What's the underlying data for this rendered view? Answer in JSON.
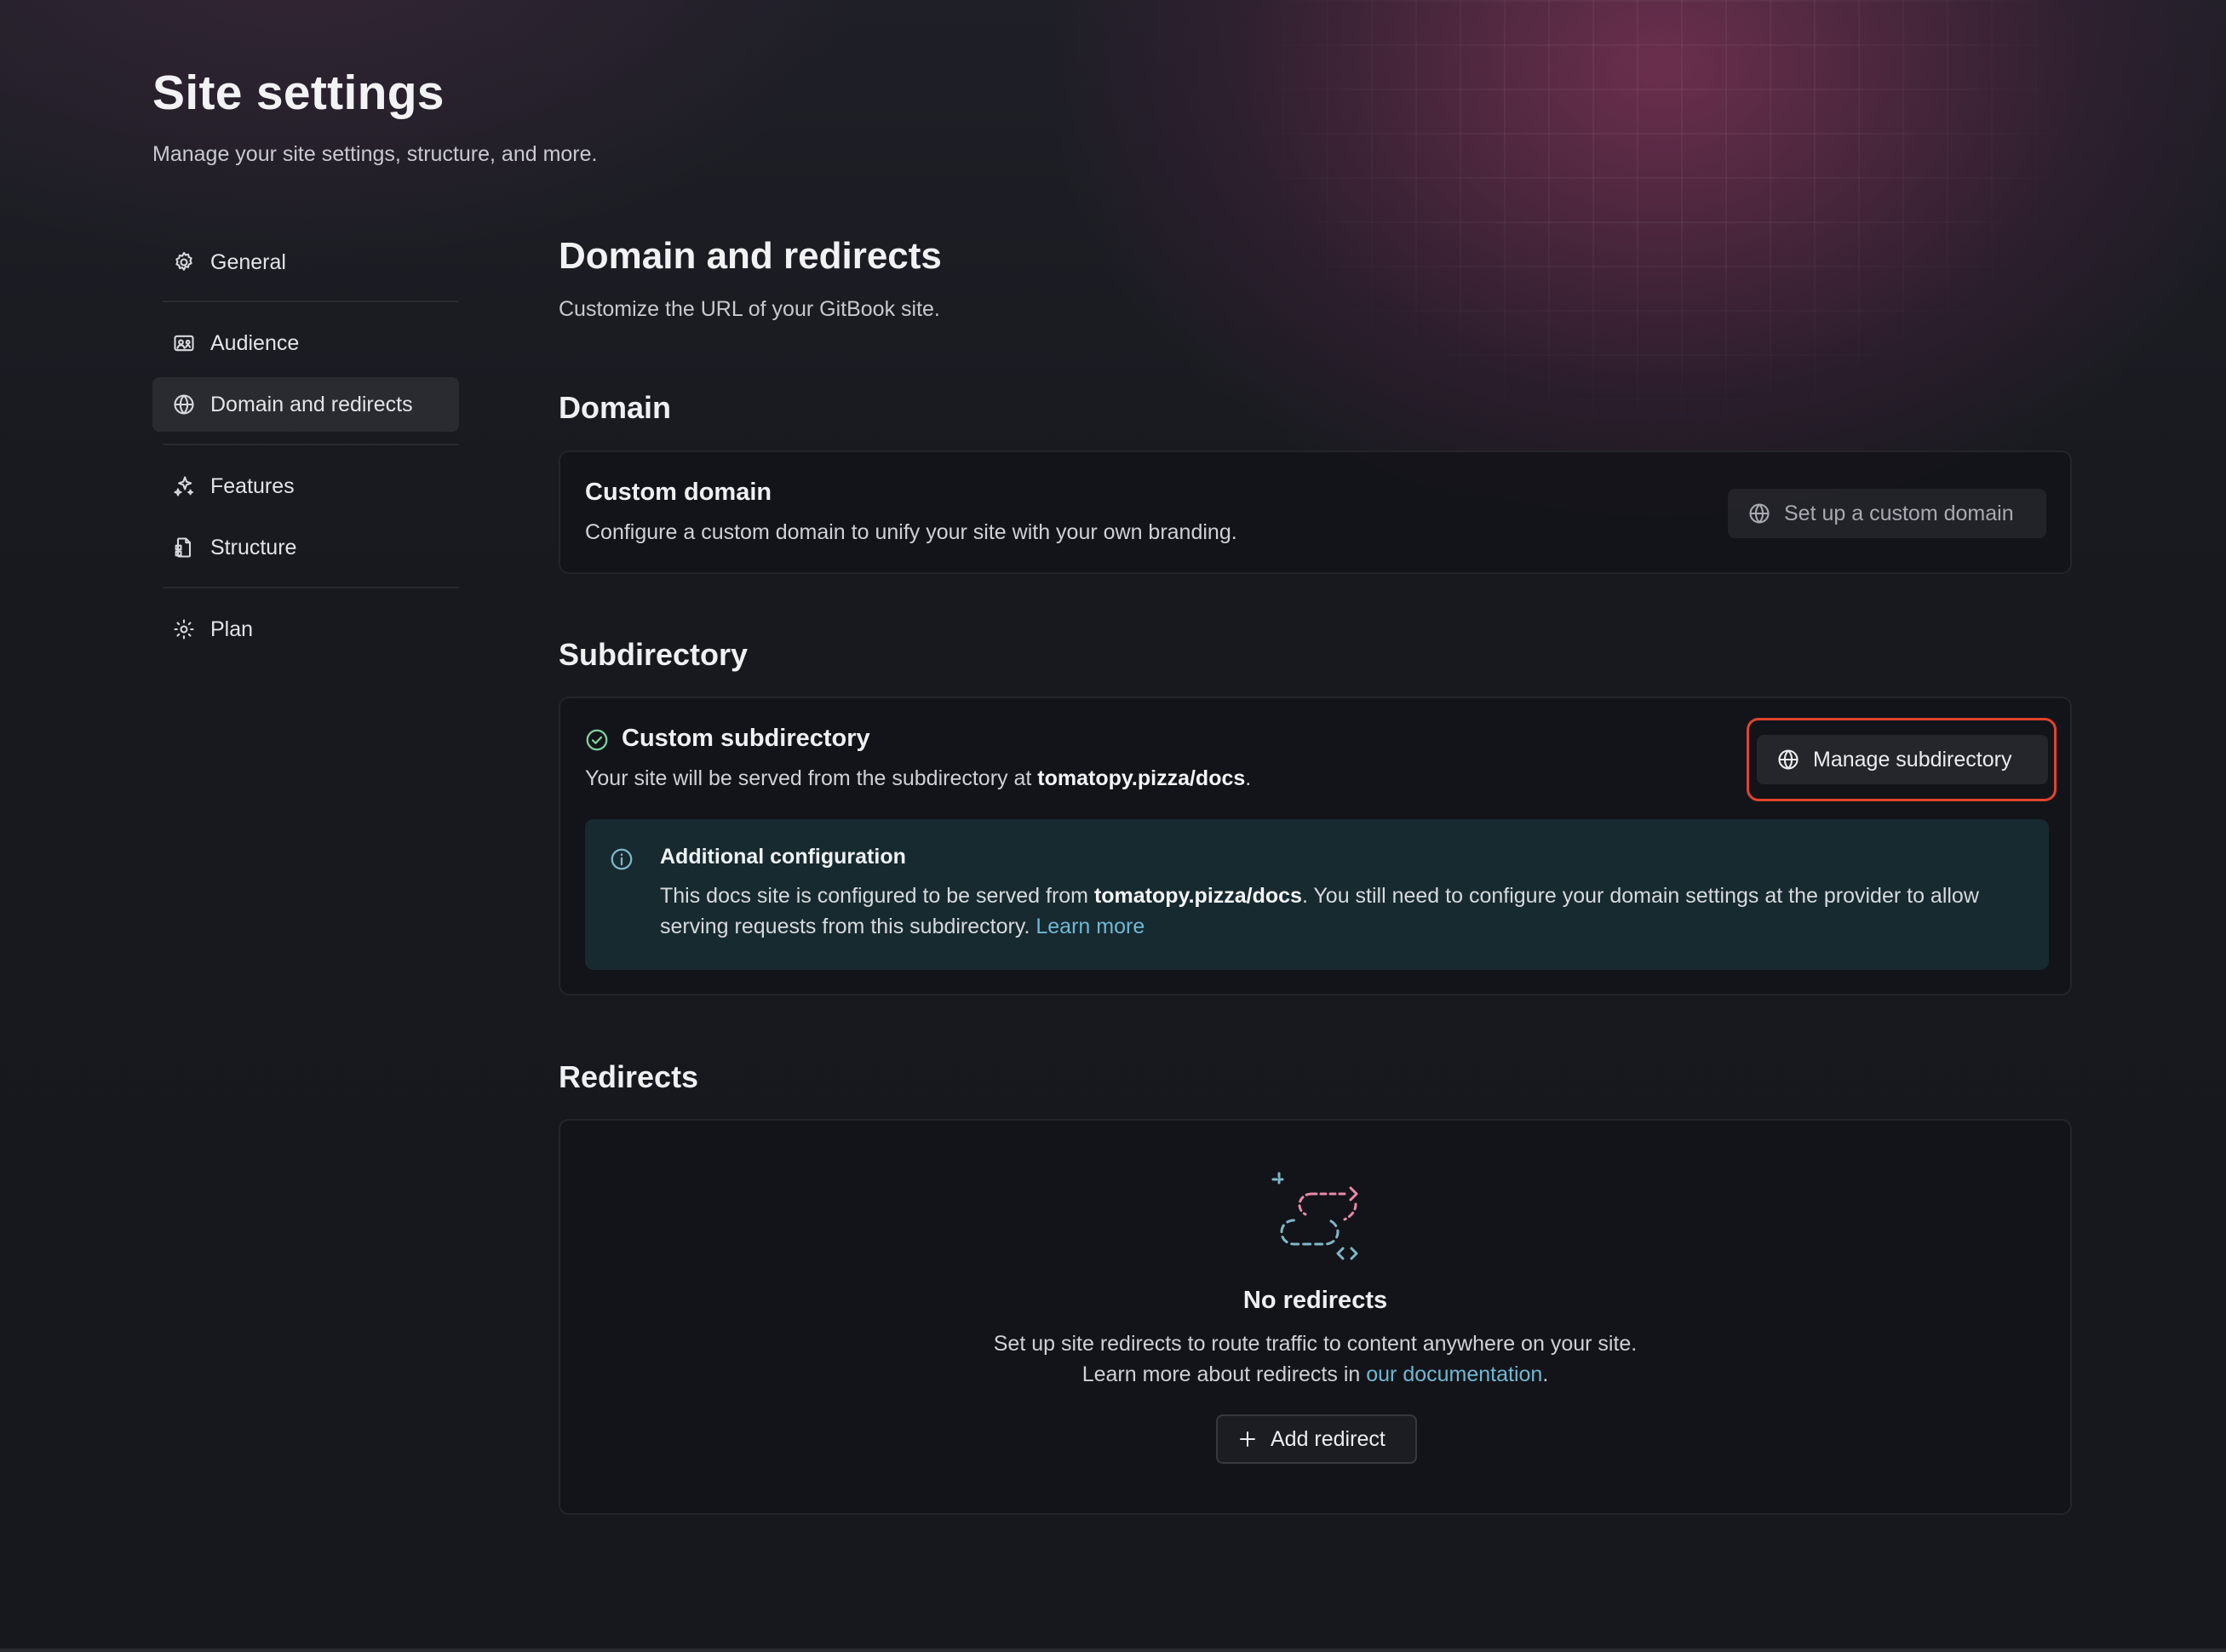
{
  "header": {
    "title": "Site settings",
    "subtitle": "Manage your site settings, structure, and more."
  },
  "sidebar": {
    "items": [
      {
        "label": "General",
        "icon": "gear-icon"
      },
      {
        "label": "Audience",
        "icon": "audience-icon"
      },
      {
        "label": "Domain and redirects",
        "icon": "globe-icon",
        "active": true
      },
      {
        "label": "Features",
        "icon": "sparkles-icon"
      },
      {
        "label": "Structure",
        "icon": "structure-icon"
      },
      {
        "label": "Plan",
        "icon": "plan-icon"
      }
    ]
  },
  "main": {
    "title": "Domain and redirects",
    "description": "Customize the URL of your GitBook site.",
    "domain": {
      "heading": "Domain",
      "card_title": "Custom domain",
      "card_desc": "Configure a custom domain to unify your site with your own branding.",
      "button_label": "Set up a custom domain"
    },
    "subdirectory": {
      "heading": "Subdirectory",
      "card_title": "Custom subdirectory",
      "card_desc_prefix": "Your site will be served from the subdirectory at ",
      "card_desc_url": "tomatopy.pizza/docs",
      "card_desc_suffix": ".",
      "button_label": "Manage subdirectory",
      "info": {
        "title": "Additional configuration",
        "text_prefix": "This docs site is configured to be served from ",
        "text_url": "tomatopy.pizza/docs",
        "text_suffix": ". You still need to configure your domain settings at the provider to allow serving requests from this subdirectory. ",
        "link": "Learn more"
      }
    },
    "redirects": {
      "heading": "Redirects",
      "empty_title": "No redirects",
      "empty_desc_line1": "Set up site redirects to route traffic to content anywhere on your site.",
      "empty_desc_line2_prefix": "Learn more about redirects in ",
      "empty_desc_link": "our documentation",
      "empty_desc_line2_suffix": ".",
      "button_label": "Add redirect"
    }
  },
  "colors": {
    "highlight": "#e0442c",
    "link": "#6fb8d3",
    "success": "#7fd3a0",
    "info_bg": "#172a30"
  }
}
